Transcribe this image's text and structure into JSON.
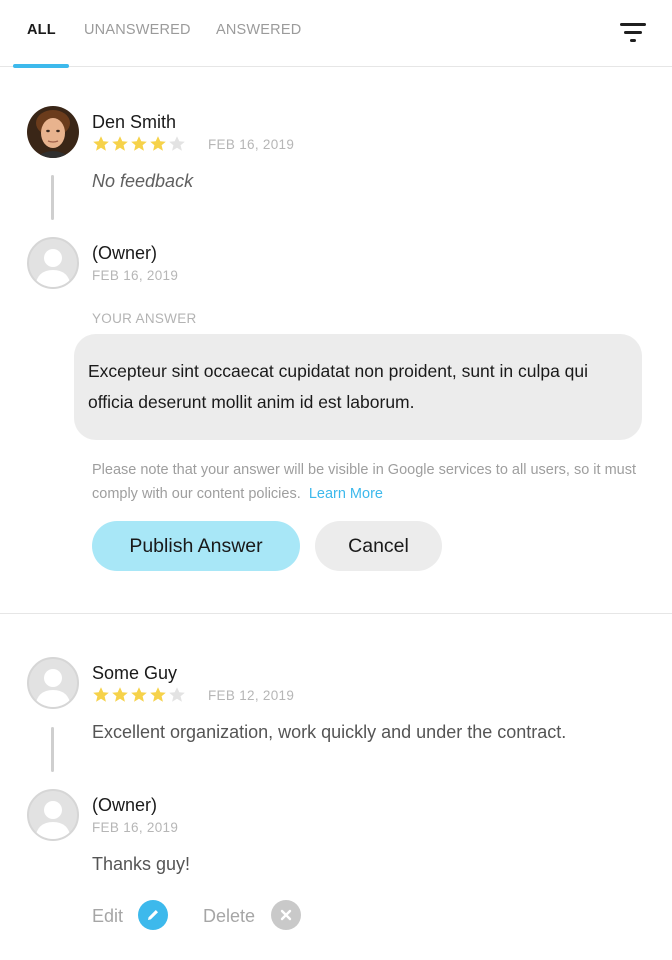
{
  "tabs": [
    {
      "label": "ALL",
      "active": true
    },
    {
      "label": "UNANSWERED",
      "active": false
    },
    {
      "label": "ANSWERED",
      "active": false
    }
  ],
  "filter_icon": "filter-icon",
  "reviews": [
    {
      "author": "Den Smith",
      "rating": 4,
      "max_rating": 5,
      "date": "FEB 16, 2019",
      "text": "No feedback",
      "reply": {
        "author": "(Owner)",
        "date": "FEB 16, 2019",
        "answer_label": "YOUR ANSWER",
        "answer_text": "Excepteur sint occaecat cupidatat non proident, sunt in culpa qui officia deserunt mollit anim id est laborum.",
        "policy_note": "Please note that your answer will be visible in Google services to all users, so it must comply with our content policies.",
        "learn_more": "Learn More",
        "publish_label": "Publish Answer",
        "cancel_label": "Cancel"
      }
    },
    {
      "author": "Some Guy",
      "rating": 4,
      "max_rating": 5,
      "date": "FEB 12, 2019",
      "text": "Excellent organization, work quickly and under the contract.",
      "reply": {
        "author": "(Owner)",
        "date": "FEB 16, 2019",
        "text": "Thanks guy!",
        "edit_label": "Edit",
        "delete_label": "Delete"
      }
    }
  ],
  "colors": {
    "accent": "#3db9ec",
    "publish_bg": "#a8e7f7",
    "star_filled": "#f6d24a",
    "star_empty": "#e3e3e3"
  }
}
